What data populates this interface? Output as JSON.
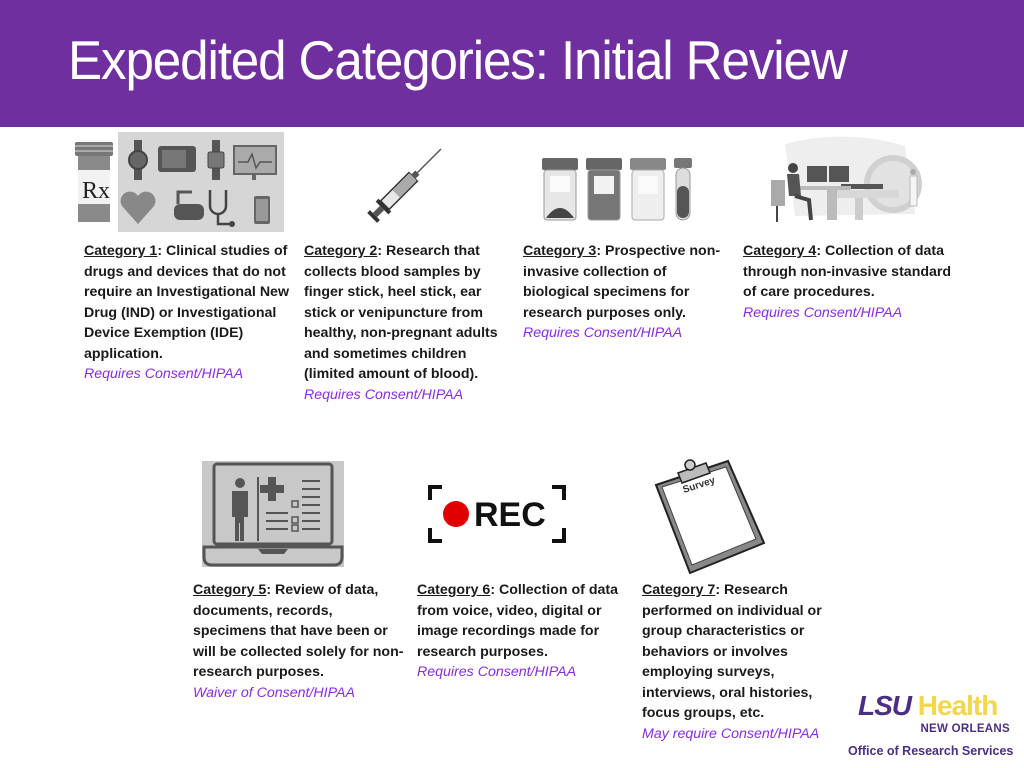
{
  "header": {
    "title": "Expedited Categories: Initial Review",
    "background_color": "#6f2f9f"
  },
  "categories": [
    {
      "label": "Category 1",
      "description": ": Clinical studies of drugs and devices that do not require an Investigational New Drug (IND) or Investigational Device Exemption (IDE) application.",
      "requirement": "Requires Consent/HIPAA",
      "image": "rx-bottle-and-medical-devices"
    },
    {
      "label": "Category 2",
      "description": ": Research that collects blood samples by finger stick, heel stick, ear stick or venipuncture from healthy, non-pregnant adults and sometimes children (limited amount of blood).",
      "requirement": "Requires Consent/HIPAA",
      "image": "syringe"
    },
    {
      "label": "Category 3",
      "description": ": Prospective non-invasive collection of biological specimens for research purposes only.",
      "requirement": "Requires Consent/HIPAA",
      "image": "specimen-jars"
    },
    {
      "label": "Category 4",
      "description": ": Collection of data through non-invasive standard of care procedures.",
      "requirement": "Requires Consent/HIPAA",
      "image": "mri-scan"
    },
    {
      "label": "Category 5",
      "description": ": Review of data, documents, records, specimens that have been or will be collected solely for non-research purposes.",
      "requirement": "Waiver of Consent/HIPAA",
      "image": "laptop-medical-record"
    },
    {
      "label": "Category 6",
      "description": ": Collection of data from voice, video, digital or image recordings made for research purposes.",
      "requirement": "Requires Consent/HIPAA",
      "image": "rec"
    },
    {
      "label": "Category 7",
      "description": ": Research performed on individual or group characteristics or behaviors or involves employing surveys, interviews, oral histories, focus groups, etc.",
      "requirement": "May require Consent/HIPAA",
      "image": "survey-clipboard"
    }
  ],
  "images": {
    "rec_label": "REC",
    "survey_label": "Survey",
    "rx_label": "Rx"
  },
  "logo": {
    "lsu": "LSU",
    "health": "Health",
    "subtitle": "NEW ORLEANS",
    "office": "Office of Research Services"
  },
  "colors": {
    "requirement_text": "#8a2be2",
    "logo_purple": "#4b2e83",
    "logo_gold": "#f2d64b",
    "rec_dot": "#e00000"
  }
}
